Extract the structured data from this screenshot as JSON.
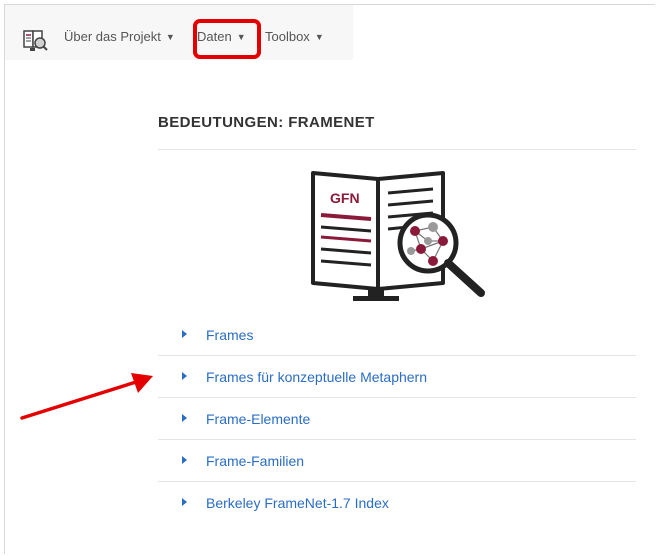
{
  "nav": {
    "items": [
      {
        "label": "Über das Projekt"
      },
      {
        "label": "Daten"
      },
      {
        "label": "Toolbox"
      }
    ]
  },
  "page": {
    "title": "BEDEUTUNGEN: FRAMENET"
  },
  "illustration": {
    "label": "GFN"
  },
  "links": [
    {
      "label": "Frames"
    },
    {
      "label": "Frames für konzeptuelle Metaphern"
    },
    {
      "label": "Frame-Elemente"
    },
    {
      "label": "Frame-Familien"
    },
    {
      "label": "Berkeley FrameNet-1.7 Index"
    }
  ],
  "colors": {
    "link": "#2a6dc4",
    "highlight": "#e50000",
    "brand": "#8b1a3a"
  }
}
